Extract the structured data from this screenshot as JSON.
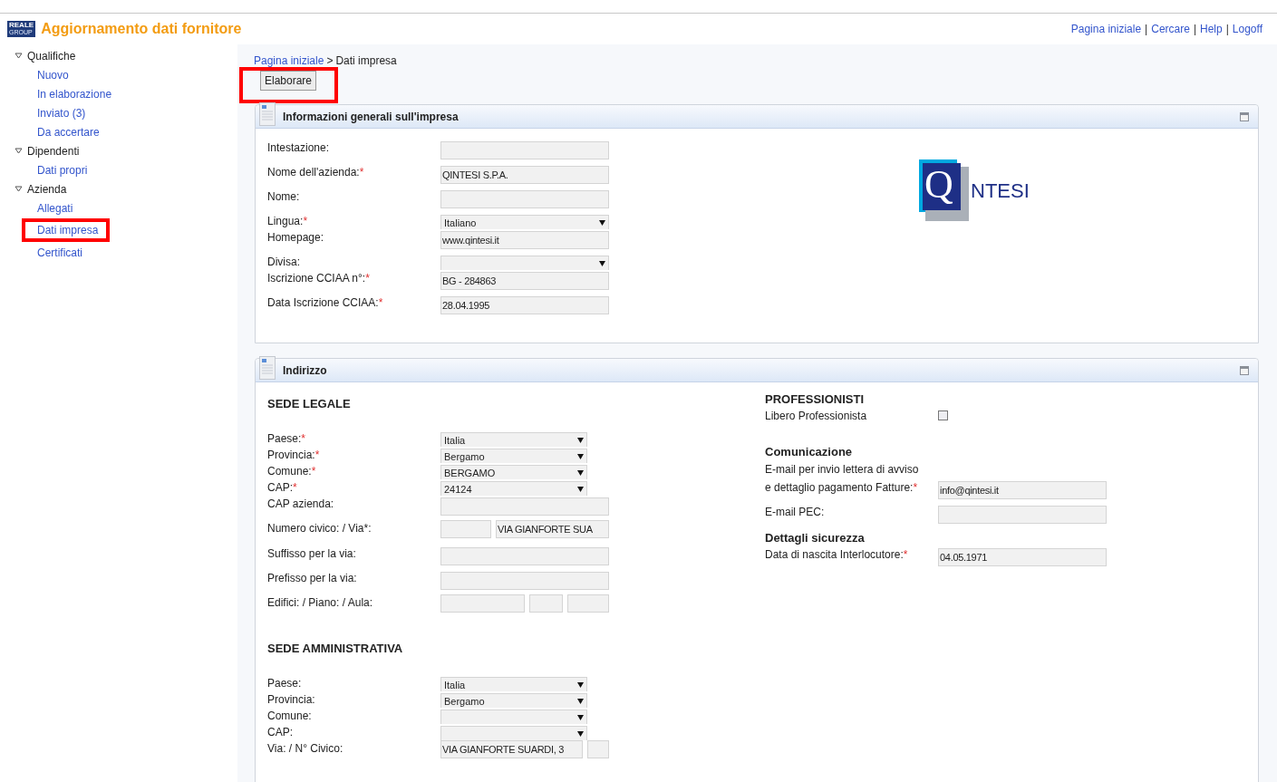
{
  "header": {
    "logo": {
      "top": "REALE",
      "bottom": "GROUP"
    },
    "title": "Aggiornamento dati fornitore",
    "separator": "|",
    "links": [
      "Pagina iniziale",
      "Cercare",
      "Help",
      "Logoff"
    ]
  },
  "sidebar": {
    "items": [
      {
        "label": "Qualifiche",
        "expanded": true,
        "children": [
          {
            "label": "Nuovo",
            "highlighted": false
          },
          {
            "label": "In elaborazione",
            "highlighted": false
          },
          {
            "label": "Inviato (3)",
            "highlighted": false
          },
          {
            "label": "Da accertare",
            "highlighted": false
          }
        ]
      },
      {
        "label": "Dipendenti",
        "expanded": true,
        "children": [
          {
            "label": "Dati propri",
            "highlighted": false
          }
        ]
      },
      {
        "label": "Azienda",
        "expanded": true,
        "children": [
          {
            "label": "Allegati",
            "highlighted": false
          },
          {
            "label": "Dati impresa",
            "highlighted": true
          },
          {
            "label": "Certificati",
            "highlighted": false
          }
        ]
      }
    ]
  },
  "breadcrumb": {
    "separator": ">",
    "items": [
      {
        "label": "Pagina iniziale",
        "link": true
      },
      {
        "label": "Dati impresa",
        "link": false
      }
    ]
  },
  "toolbar": {
    "button": {
      "label": "Elaborare",
      "highlighted": true
    }
  },
  "panels": [
    {
      "title": "Informazioni generali sull'impresa",
      "logo": {
        "letter": "Q",
        "word": "NTESI"
      },
      "columns": [
        [
          {
            "kind": "text",
            "label": "Intestazione:"
          },
          {
            "kind": "text",
            "label": "Nome dell'azienda:",
            "required_mark": "*",
            "value": "QINTESI S.P.A."
          },
          {
            "kind": "text",
            "label": "Nome:"
          },
          {
            "kind": "select",
            "label": "Lingua:",
            "required_mark": "*",
            "value": "Italiano"
          },
          {
            "kind": "text",
            "label": "Homepage:",
            "value": "www.qintesi.it"
          },
          {
            "kind": "select",
            "label": "Divisa:"
          },
          {
            "kind": "text",
            "label": "Iscrizione CCIAA n°:",
            "required_mark": "*",
            "value": "BG - 284863"
          },
          {
            "kind": "text",
            "label": "Data Iscrizione CCIAA:",
            "required_mark": "*",
            "value": "28.04.1995"
          }
        ]
      ]
    },
    {
      "title": "Indirizzo",
      "columns": [
        [
          {
            "kind": "heading",
            "text": "SEDE LEGALE"
          },
          {
            "kind": "select",
            "label": "Paese:",
            "required_mark": "*",
            "value": "Italia"
          },
          {
            "kind": "select",
            "label": "Provincia:",
            "required_mark": "*",
            "value": "Bergamo"
          },
          {
            "kind": "select",
            "label": "Comune:",
            "required_mark": "*",
            "value": "BERGAMO"
          },
          {
            "kind": "select",
            "label": "CAP:",
            "required_mark": "*",
            "value": "24124"
          },
          {
            "kind": "text",
            "label": "CAP azienda:"
          },
          {
            "kind": "split",
            "label": "Numero civico: / Via*:",
            "parts": [
              {
                "kind": "input"
              },
              {
                "kind": "input",
                "value": "VIA GIANFORTE SUA"
              }
            ]
          },
          {
            "kind": "text",
            "label": "Suffisso per la via:"
          },
          {
            "kind": "text",
            "label": "Prefisso per la via:"
          },
          {
            "kind": "split",
            "label": "Edifici: / Piano: / Aula:",
            "parts": [
              {
                "kind": "input"
              },
              {
                "kind": "input"
              },
              {
                "kind": "input"
              }
            ]
          },
          {
            "kind": "heading",
            "text": "SEDE AMMINISTRATIVA"
          },
          {
            "kind": "select",
            "label": "Paese:",
            "value": "Italia"
          },
          {
            "kind": "select",
            "label": "Provincia:",
            "value": "Bergamo"
          },
          {
            "kind": "select",
            "label": "Comune:"
          },
          {
            "kind": "select",
            "label": "CAP:"
          },
          {
            "kind": "split",
            "label": "Via: / N° Civico:",
            "parts": [
              {
                "kind": "input",
                "value": "VIA GIANFORTE SUARDI, 3"
              },
              {
                "kind": "input"
              }
            ]
          }
        ],
        [
          {
            "kind": "subheading",
            "text": "PROFESSIONISTI"
          },
          {
            "kind": "checkbox",
            "label": "Libero Professionista",
            "checked": false
          },
          {
            "kind": "subheading",
            "text": "Comunicazione"
          },
          {
            "kind": "text",
            "pre_label": "E-mail per invio lettera di avviso",
            "label": "e dettaglio pagamento Fatture:",
            "required_mark": "*",
            "value": "info@qintesi.it"
          },
          {
            "kind": "text",
            "label": "E-mail PEC:"
          },
          {
            "kind": "subheading",
            "text": "Dettagli sicurezza"
          },
          {
            "kind": "text",
            "label": "Data di nascita Interlocutore:",
            "required_mark": "*",
            "value": "04.05.1971"
          }
        ]
      ]
    }
  ]
}
